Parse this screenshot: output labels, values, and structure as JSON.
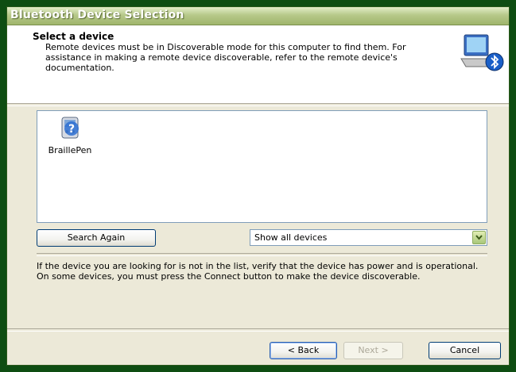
{
  "window": {
    "title": "Bluetooth Device Selection"
  },
  "header": {
    "title": "Select a device",
    "subtitle": "Remote devices must be in Discoverable mode for this computer to find them. For assistance in making a remote device discoverable, refer to the remote device's documentation.",
    "icon": "bluetooth-computer-icon"
  },
  "device_list": {
    "items": [
      {
        "label": "BraillePen",
        "icon": "unknown-device-icon"
      }
    ]
  },
  "controls": {
    "search_again_label": "Search Again",
    "filter_selected": "Show all devices"
  },
  "info": {
    "text": "If the device you are looking for is not in the list, verify that the device has power and is operational. On some devices, you must press the Connect button to make the device discoverable."
  },
  "buttons": {
    "back_label": "< Back",
    "next_label": "Next >",
    "cancel_label": "Cancel"
  },
  "colors": {
    "titlebar": "#9fb56c",
    "dialog_bg": "#ece9d8",
    "desktop": "#0e4d12"
  }
}
